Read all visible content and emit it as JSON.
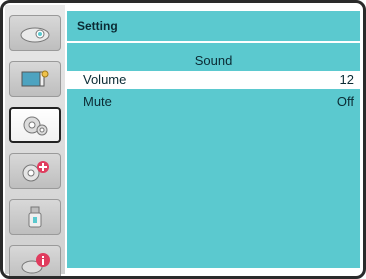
{
  "header": {
    "title": "Setting"
  },
  "menu": {
    "subtitle": "Sound",
    "rows": [
      {
        "label": "Volume",
        "value": "12"
      },
      {
        "label": "Mute",
        "value": "Off"
      }
    ]
  },
  "sidebar": {
    "icons": [
      {
        "name": "input-icon"
      },
      {
        "name": "image-adjust-icon"
      },
      {
        "name": "setting-gear-icon"
      },
      {
        "name": "expand-gears-icon"
      },
      {
        "name": "usb-memory-icon"
      },
      {
        "name": "info-icon"
      }
    ]
  },
  "colors": {
    "panel": "#5bc9cf",
    "highlight": "#ffffff"
  }
}
